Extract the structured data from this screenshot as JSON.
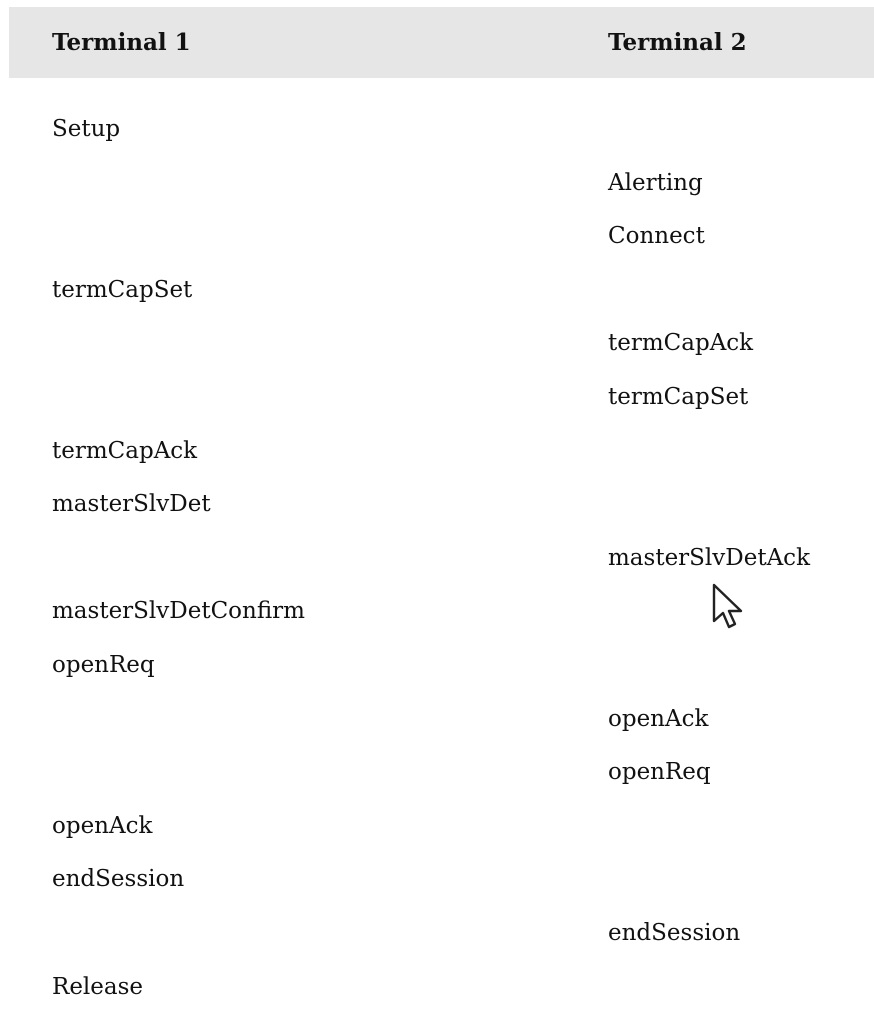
{
  "table": {
    "headers": [
      "Terminal 1",
      "Terminal 2"
    ],
    "rows": [
      {
        "t1": "Setup",
        "t2": ""
      },
      {
        "t1": "",
        "t2": "Alerting"
      },
      {
        "t1": "",
        "t2": "Connect"
      },
      {
        "t1": "termCapSet",
        "t2": ""
      },
      {
        "t1": "",
        "t2": "termCapAck"
      },
      {
        "t1": "",
        "t2": "termCapSet"
      },
      {
        "t1": "termCapAck",
        "t2": ""
      },
      {
        "t1": "masterSlvDet",
        "t2": ""
      },
      {
        "t1": "",
        "t2": "masterSlvDetAck"
      },
      {
        "t1": "masterSlvDetConfirm",
        "t2": ""
      },
      {
        "t1": "openReq",
        "t2": ""
      },
      {
        "t1": "",
        "t2": "openAck"
      },
      {
        "t1": "",
        "t2": "openReq"
      },
      {
        "t1": "openAck",
        "t2": ""
      },
      {
        "t1": "endSession",
        "t2": ""
      },
      {
        "t1": "",
        "t2": "endSession"
      },
      {
        "t1": "Release",
        "t2": ""
      }
    ]
  },
  "cursor": {
    "icon": "mouse-pointer-icon"
  }
}
